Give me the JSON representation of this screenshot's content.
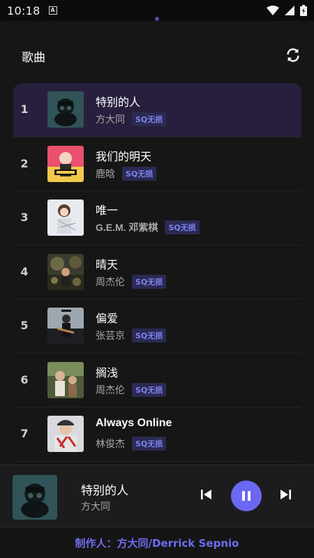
{
  "status_bar": {
    "time": "10:18",
    "notification_icon": "a-icon",
    "icons": [
      "wifi-icon",
      "signal-icon",
      "battery-icon"
    ]
  },
  "header": {
    "title": "歌曲",
    "refresh_icon": "refresh-icon"
  },
  "songs": [
    {
      "index": "1",
      "title": "特别的人",
      "artist": "方大同",
      "badge": "SQ无损",
      "active": true
    },
    {
      "index": "2",
      "title": "我们的明天",
      "artist": "鹿晗",
      "badge": "SQ无损",
      "active": false
    },
    {
      "index": "3",
      "title": "唯一",
      "artist": "G.E.M. 邓紫棋",
      "badge": "SQ无损",
      "active": false
    },
    {
      "index": "4",
      "title": "晴天",
      "artist": "周杰伦",
      "badge": "SQ无损",
      "active": false
    },
    {
      "index": "5",
      "title": "偏爱",
      "artist": "张芸京",
      "badge": "SQ无损",
      "active": false
    },
    {
      "index": "6",
      "title": "搁浅",
      "artist": "周杰伦",
      "badge": "SQ无损",
      "active": false
    },
    {
      "index": "7",
      "title": "Always Online",
      "artist": "林俊杰",
      "badge": "SQ无损",
      "active": false
    }
  ],
  "now_playing": {
    "title": "特别的人",
    "artist": "方大同",
    "controls": [
      "previous-icon",
      "pause-icon",
      "next-icon"
    ]
  },
  "footer": {
    "credit": "制作人：方大同/Derrick Sepnio"
  },
  "colors": {
    "accent": "#6a68f2",
    "badge_text": "#7f82ee",
    "badge_bg": "#2a2a52",
    "active_row": "#271f3d"
  }
}
